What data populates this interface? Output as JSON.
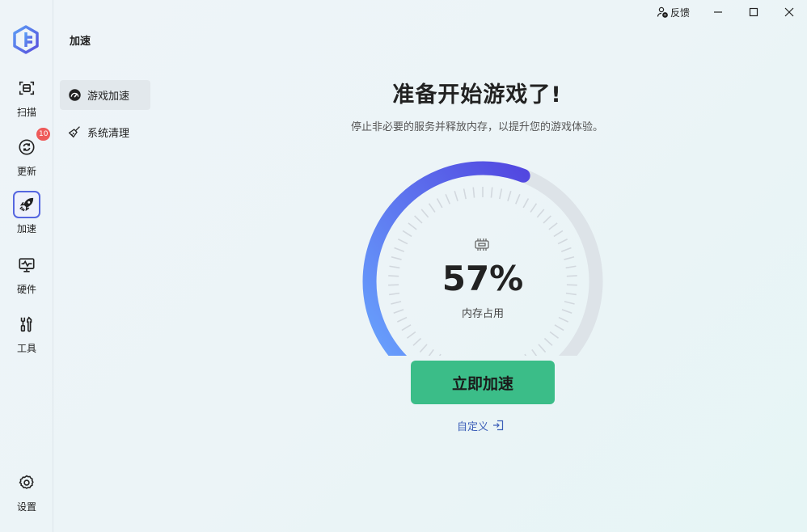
{
  "sidebar": {
    "items": [
      {
        "label": "扫描",
        "icon": "scan-icon"
      },
      {
        "label": "更新",
        "icon": "refresh-icon",
        "badge": "10"
      },
      {
        "label": "加速",
        "icon": "rocket-icon",
        "active": true
      },
      {
        "label": "硬件",
        "icon": "monitor-pulse-icon"
      },
      {
        "label": "工具",
        "icon": "tools-icon"
      },
      {
        "label": "设置",
        "icon": "gear-icon"
      }
    ]
  },
  "section": {
    "title": "加速"
  },
  "subnav": [
    {
      "label": "游戏加速",
      "icon": "speedometer-icon",
      "active": true
    },
    {
      "label": "系统清理",
      "icon": "broom-icon"
    }
  ],
  "titlebar": {
    "feedback_label": "反馈"
  },
  "main": {
    "headline": "准备开始游戏了!",
    "subline": "停止非必要的服务并释放内存，以提升您的游戏体验。",
    "gauge": {
      "percent_text": "57%",
      "value": 0.57,
      "label": "内存占用",
      "icon": "memory-chip-icon"
    },
    "boost_button": "立即加速",
    "customize_link": "自定义"
  },
  "colors": {
    "accent": "#5566e0",
    "gauge_start": "#6aa8ff",
    "gauge_end": "#5247e0",
    "gauge_track": "#dde3e8",
    "button": "#3bbd88",
    "link": "#3d5fb8",
    "badge": "#ee5a5a"
  }
}
